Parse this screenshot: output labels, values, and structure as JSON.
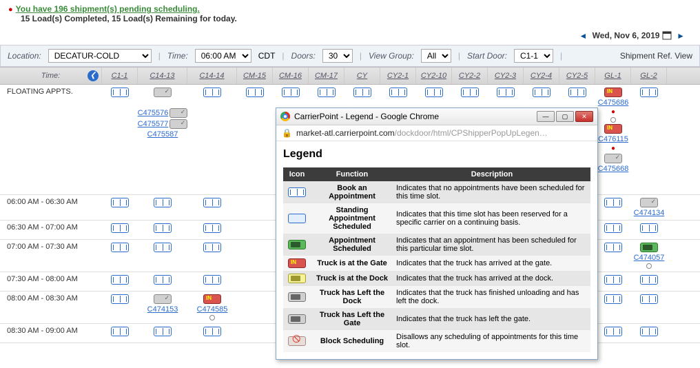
{
  "alerts": {
    "pending_link": "You have 196 shipment(s) pending scheduling.",
    "status": "15 Load(s) Completed, 15 Load(s) Remaining for today."
  },
  "datebar": {
    "prev": "◄",
    "date": "Wed, Nov 6, 2019",
    "next": "►"
  },
  "controls": {
    "location_label": "Location:",
    "location_value": "DECATUR-COLD",
    "time_label": "Time:",
    "time_value": "06:00 AM",
    "tz": "CDT",
    "doors_label": "Doors:",
    "doors_value": "30",
    "viewgroup_label": "View Group:",
    "viewgroup_value": "All",
    "startdoor_label": "Start Door:",
    "startdoor_value": "C1-1",
    "ship_ref": "Shipment Ref. View"
  },
  "headers": {
    "time": "Time:",
    "cols": [
      "C1-1",
      "C14-13",
      "C14-14",
      "CM-15",
      "CM-16",
      "CM-17",
      "CY",
      "CY2-1",
      "CY2-10",
      "CY2-2",
      "CY2-3",
      "CY2-4",
      "CY2-5",
      "GL-1",
      "GL-2"
    ]
  },
  "rows": {
    "floating": {
      "label": "FLOATING APPTS.",
      "c14_13_links": [
        "C475576",
        "C475577",
        "C475587"
      ],
      "gl1_link1": "C475686",
      "gl1_link2": "C476115",
      "gl1_link3": "C475668"
    },
    "r0600": {
      "label": "06:00 AM - 06:30 AM",
      "gl2_link": "C474134"
    },
    "r0630": {
      "label": "06:30 AM - 07:00 AM"
    },
    "r0700": {
      "label": "07:00 AM - 07:30 AM",
      "gl2_link": "C474057"
    },
    "r0730": {
      "label": "07:30 AM - 08:00 AM"
    },
    "r0800": {
      "label": "08:00 AM - 08:30 AM",
      "c14_13_link": "C474153",
      "c14_14_link": "C474585"
    },
    "r0830": {
      "label": "08:30 AM - 09:00 AM"
    }
  },
  "popup": {
    "title": "CarrierPoint - Legend - Google Chrome",
    "url_domain": "market-atl.carrierpoint.com",
    "url_path": "/dockdoor/html/CPShipperPopUpLegen…",
    "heading": "Legend",
    "th_icon": "Icon",
    "th_func": "Function",
    "th_desc": "Description",
    "rows": [
      {
        "icon": "book",
        "func": "Book an Appointment",
        "desc": "Indicates that no appointments have been scheduled for this time slot."
      },
      {
        "icon": "standing",
        "func": "Standing Appointment Scheduled",
        "desc": "Indicates that this time slot has been reserved for a specific carrier on a continuing basis."
      },
      {
        "icon": "green",
        "func": "Appointment Scheduled",
        "desc": "Indicates that an appointment has been scheduled for this particular time slot."
      },
      {
        "icon": "red",
        "func": "Truck is at the Gate",
        "desc": "Indicates that the truck has arrived at the gate."
      },
      {
        "icon": "yellow",
        "func": "Truck is at the Dock",
        "desc": "Indicates that the truck has arrived at the dock."
      },
      {
        "icon": "left",
        "func": "Truck has Left the Dock",
        "desc": "Indicates that the truck has finished unloading and has left the dock."
      },
      {
        "icon": "left",
        "func": "Truck has Left the Gate",
        "desc": "Indicates that the truck has left the gate."
      },
      {
        "icon": "block",
        "func": "Block Scheduling",
        "desc": "Disallows any scheduling of appointments for this time slot."
      }
    ]
  }
}
